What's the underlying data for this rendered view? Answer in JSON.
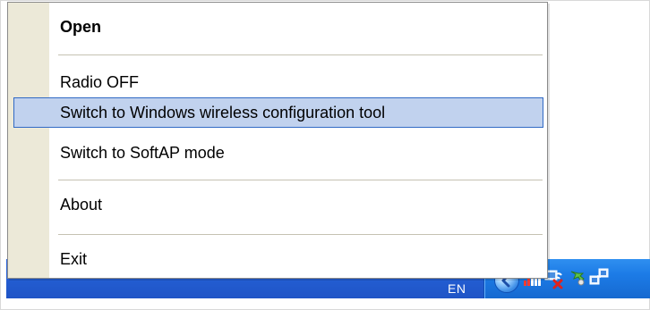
{
  "menu": {
    "items": [
      {
        "label": "Open",
        "bold": true
      },
      {
        "label": "Radio OFF"
      },
      {
        "label": "Switch to Windows wireless configuration tool",
        "selected": true
      },
      {
        "label": "Switch to SoftAP mode"
      },
      {
        "label": "About"
      },
      {
        "label": "Exit"
      }
    ]
  },
  "taskbar": {
    "language": "EN",
    "tray_icons": [
      "show-hidden-icons-chevron",
      "signal-strength-icon",
      "network-disconnected-icon",
      "utility-icon",
      "network-connections-icon"
    ]
  },
  "colors": {
    "menu_sidebar": "#ece9d8",
    "selection_fill": "#c1d2ee",
    "selection_border": "#316ac5",
    "taskbar": "#245fd4",
    "tray": "#1c7be6"
  }
}
